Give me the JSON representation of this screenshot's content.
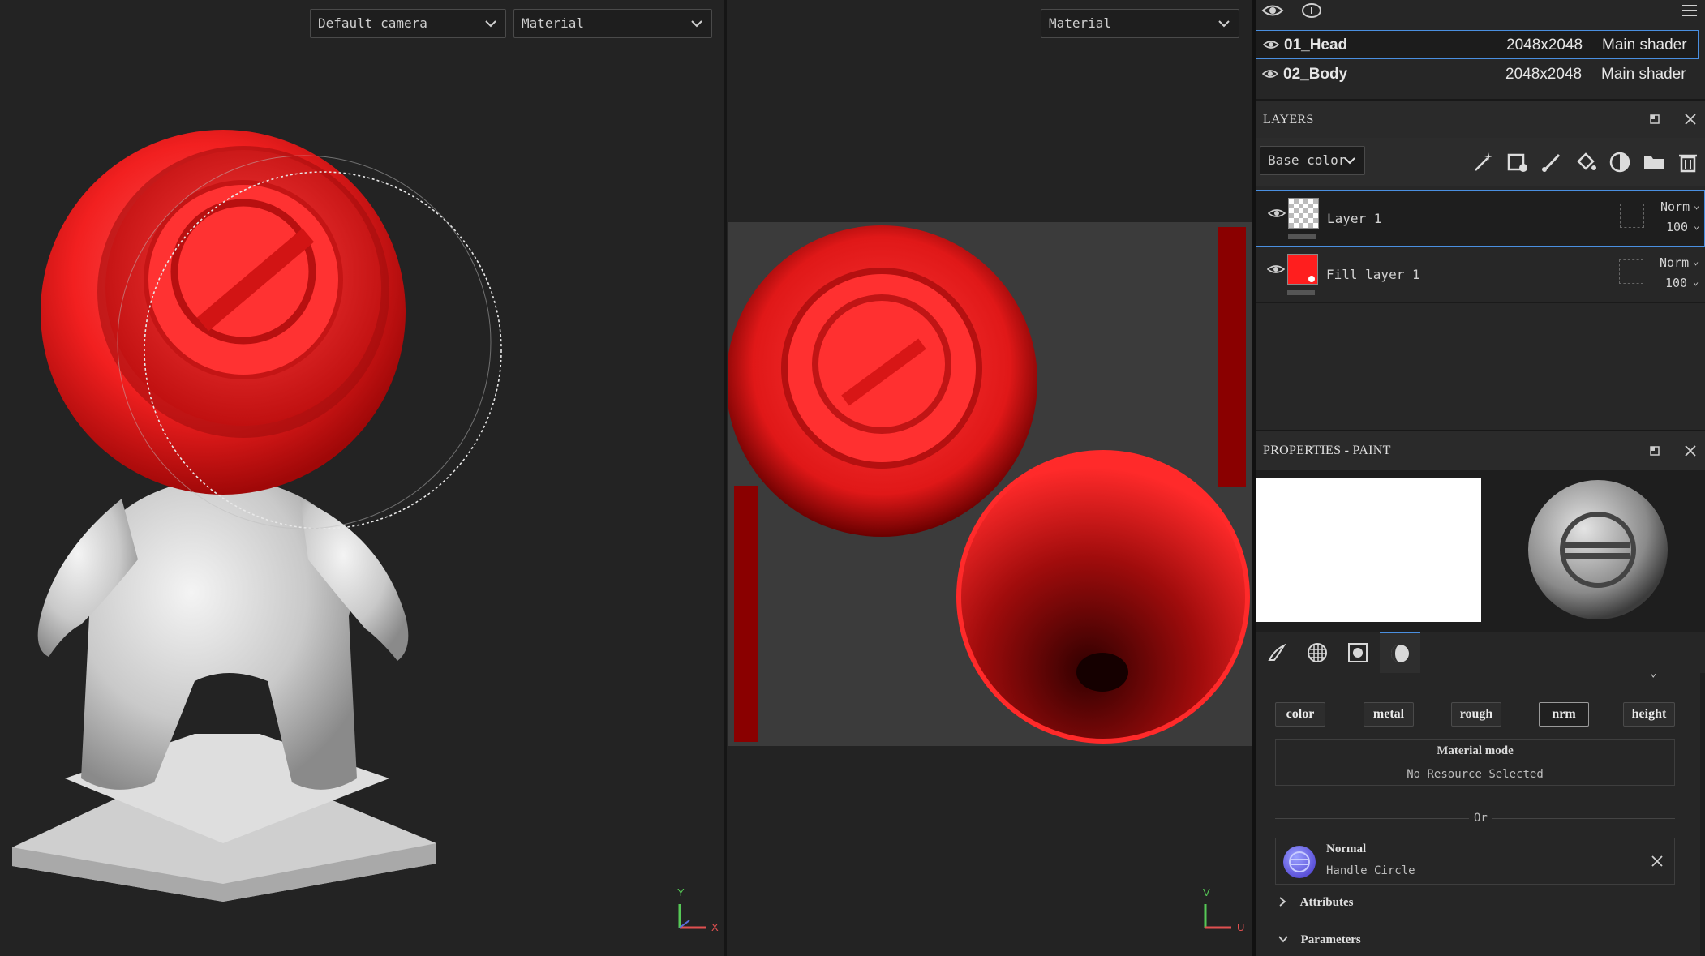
{
  "viewport3d": {
    "camera_select": "Default camera",
    "material_select": "Material",
    "axis_y": "Y",
    "axis_x": "X"
  },
  "viewport2d": {
    "material_select": "Material",
    "axis_v": "V",
    "axis_u": "U"
  },
  "texture_sets": [
    {
      "name": "01_Head",
      "resolution": "2048x2048",
      "shader": "Main shader",
      "selected": true
    },
    {
      "name": "02_Body",
      "resolution": "2048x2048",
      "shader": "Main shader",
      "selected": false
    }
  ],
  "layers_panel": {
    "title": "LAYERS",
    "channel_select": "Base color",
    "tool_icons": [
      "magic-wand-icon",
      "effects-icon",
      "paint-brush-icon",
      "fill-bucket-icon",
      "smart-material-icon",
      "folder-icon",
      "trash-icon"
    ],
    "layers": [
      {
        "name": "Layer 1",
        "blend": "Norm",
        "opacity": "100",
        "selected": true,
        "thumb": "checker"
      },
      {
        "name": "Fill layer 1",
        "blend": "Norm",
        "opacity": "100",
        "selected": false,
        "thumb": "#ff1e1e"
      }
    ]
  },
  "properties_panel": {
    "title": "PROPERTIES - PAINT",
    "tabs": [
      "brush-tab-icon",
      "alpha-tab-icon",
      "stencil-tab-icon",
      "material-tab-icon"
    ],
    "channels": [
      "color",
      "metal",
      "rough",
      "nrm",
      "height"
    ],
    "active_channel": "nrm",
    "material_mode_label": "Material mode",
    "no_resource": "No Resource Selected",
    "or_label": "Or",
    "resource": {
      "type": "Normal",
      "name": "Handle Circle"
    },
    "attributes_label": "Attributes",
    "parameters_label": "Parameters"
  },
  "colors": {
    "accent_blue": "#4a8fe0",
    "paint_red": "#ff2020",
    "panel_bg": "#262626",
    "viewport_bg": "#232323"
  }
}
